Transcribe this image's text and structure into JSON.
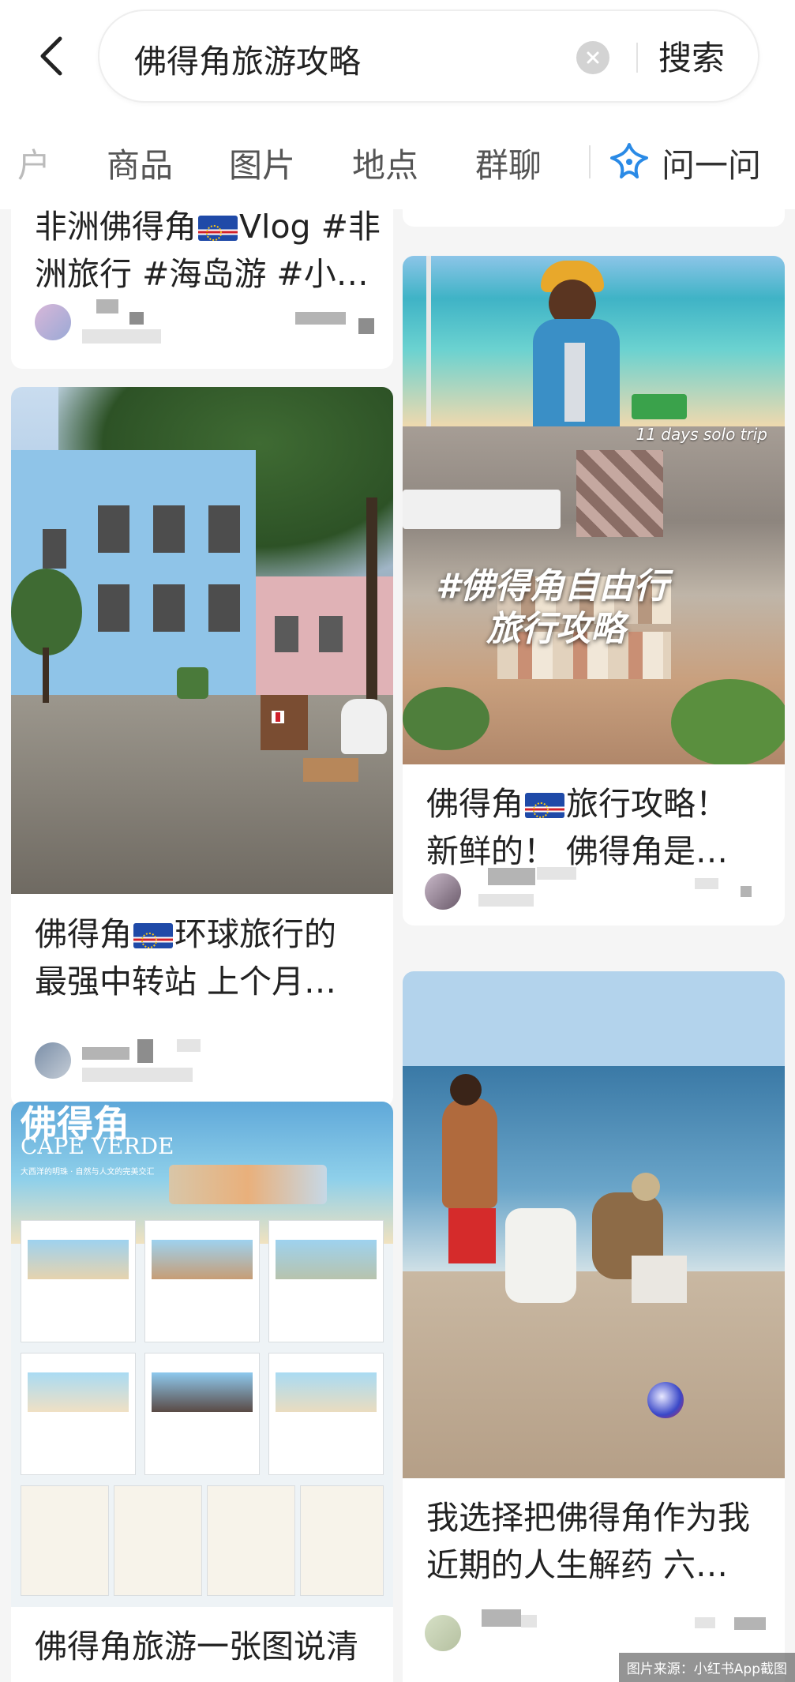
{
  "header": {
    "search_query": "佛得角旅游攻略",
    "search_button": "搜索"
  },
  "tabs": {
    "partial": "户",
    "items": [
      "商品",
      "图片",
      "地点",
      "群聊"
    ],
    "ask_label": "问一问"
  },
  "feed": {
    "card1": {
      "title_line1": "非洲佛得角",
      "title_line1b": "Vlog #非",
      "title_line2": "洲旅行 #海岛游 #小…"
    },
    "card2": {
      "title_line1a": "佛得角",
      "title_line1b": "环球旅行的",
      "title_line2": "最强中转站 上个月…"
    },
    "card3": {
      "image_header": "佛得角",
      "image_subheader": "CAPE VERDE",
      "image_tagline": "大西洋的明珠 · 自然与人文的完美交汇",
      "title_line1": "佛得角旅游一张图说清"
    },
    "card4": {
      "overlay_top": "11 days solo trip",
      "overlay_line1": "#佛得角自由行",
      "overlay_line2": "旅行攻略",
      "title_line1a": "佛得角",
      "title_line1b": "旅行攻略！",
      "title_line2": "新鲜的！ 佛得角是…"
    },
    "card5": {
      "title_line1": "我选择把佛得角作为我",
      "title_line2": "近期的人生解药 六…"
    }
  },
  "watermark": "图片来源：小红书App截图"
}
